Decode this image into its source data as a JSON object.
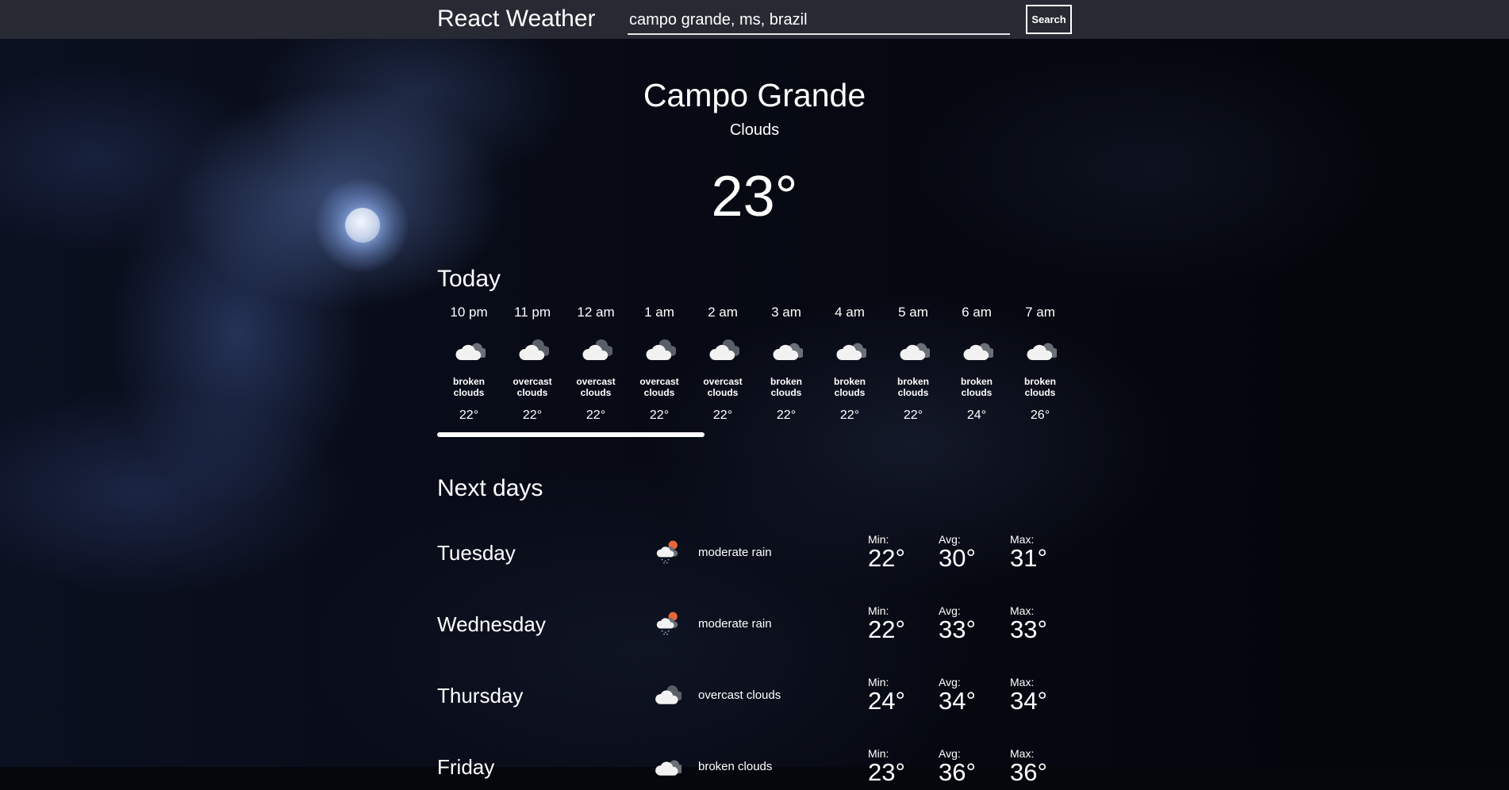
{
  "header": {
    "brand": "React Weather",
    "search_value": "campo grande, ms, brazil",
    "search_label": "Search"
  },
  "current": {
    "city": "Campo Grande",
    "condition": "Clouds",
    "temp": "23°"
  },
  "today": {
    "title": "Today",
    "hours": [
      {
        "time": "10 pm",
        "desc": "broken clouds",
        "temp": "22°",
        "icon": "broken-clouds-night-icon"
      },
      {
        "time": "11 pm",
        "desc": "overcast clouds",
        "temp": "22°",
        "icon": "overcast-clouds-icon"
      },
      {
        "time": "12 am",
        "desc": "overcast clouds",
        "temp": "22°",
        "icon": "overcast-clouds-icon"
      },
      {
        "time": "1 am",
        "desc": "overcast clouds",
        "temp": "22°",
        "icon": "overcast-clouds-icon"
      },
      {
        "time": "2 am",
        "desc": "overcast clouds",
        "temp": "22°",
        "icon": "overcast-clouds-icon"
      },
      {
        "time": "3 am",
        "desc": "broken clouds",
        "temp": "22°",
        "icon": "broken-clouds-night-icon"
      },
      {
        "time": "4 am",
        "desc": "broken clouds",
        "temp": "22°",
        "icon": "broken-clouds-night-icon"
      },
      {
        "time": "5 am",
        "desc": "broken clouds",
        "temp": "22°",
        "icon": "broken-clouds-night-icon"
      },
      {
        "time": "6 am",
        "desc": "broken clouds",
        "temp": "24°",
        "icon": "broken-clouds-night-icon"
      },
      {
        "time": "7 am",
        "desc": "broken clouds",
        "temp": "26°",
        "icon": "broken-clouds-night-icon"
      }
    ]
  },
  "next_days": {
    "title": "Next days",
    "min_label": "Min:",
    "avg_label": "Avg:",
    "max_label": "Max:",
    "days": [
      {
        "name": "Tuesday",
        "desc": "moderate rain",
        "min": "22°",
        "avg": "30°",
        "max": "31°",
        "icon": "rain-sun-icon"
      },
      {
        "name": "Wednesday",
        "desc": "moderate rain",
        "min": "22°",
        "avg": "33°",
        "max": "33°",
        "icon": "rain-sun-icon"
      },
      {
        "name": "Thursday",
        "desc": "overcast clouds",
        "min": "24°",
        "avg": "34°",
        "max": "34°",
        "icon": "overcast-clouds-icon"
      },
      {
        "name": "Friday",
        "desc": "broken clouds",
        "min": "23°",
        "avg": "36°",
        "max": "36°",
        "icon": "broken-clouds-icon"
      }
    ]
  },
  "colors": {
    "header_bg": "#272a33",
    "text": "#ffffff",
    "sun_orange": "#e8673a"
  }
}
